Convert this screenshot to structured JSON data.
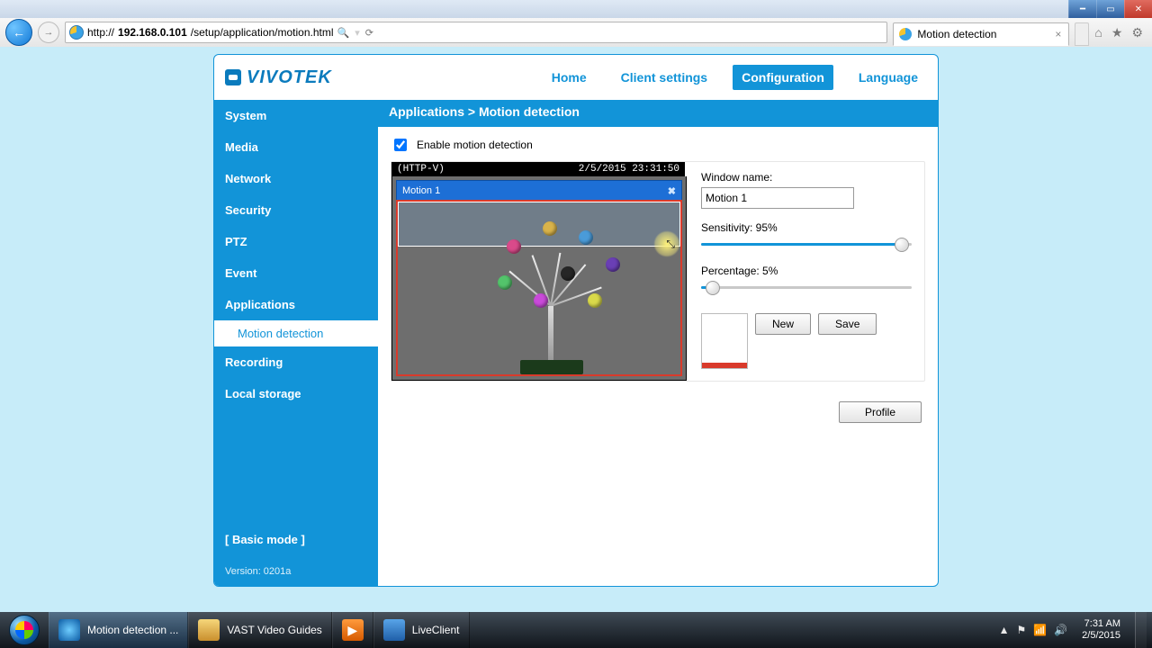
{
  "browser": {
    "url_prefix": "http://",
    "url_host": "192.168.0.101",
    "url_path": "/setup/application/motion.html",
    "tab_title": "Motion detection"
  },
  "logo_text": "VIVOTEK",
  "topnav": {
    "home": "Home",
    "client": "Client settings",
    "config": "Configuration",
    "lang": "Language"
  },
  "breadcrumb": "Applications  > Motion detection",
  "sidebar": {
    "items": [
      "System",
      "Media",
      "Network",
      "Security",
      "PTZ",
      "Event",
      "Applications"
    ],
    "sub": "Motion detection",
    "items2": [
      "Recording",
      "Local storage"
    ],
    "basic": "[ Basic mode ]",
    "version": "Version: 0201a"
  },
  "main": {
    "enable_label": "Enable motion detection",
    "stream_label": "(HTTP-V)",
    "stream_time": "2/5/2015 23:31:50",
    "motion_window_title": "Motion 1",
    "window_name_label": "Window name:",
    "window_name_value": "Motion 1",
    "sensitivity_label": "Sensitivity: 95%",
    "sensitivity_pct": 95,
    "percentage_label": "Percentage: 5%",
    "percentage_pct": 5,
    "new_btn": "New",
    "save_btn": "Save",
    "profile_btn": "Profile"
  },
  "taskbar": {
    "ie": "Motion detection ...",
    "folder": "VAST Video Guides",
    "media": "",
    "live": "LiveClient",
    "time": "7:31 AM",
    "date": "2/5/2015"
  }
}
